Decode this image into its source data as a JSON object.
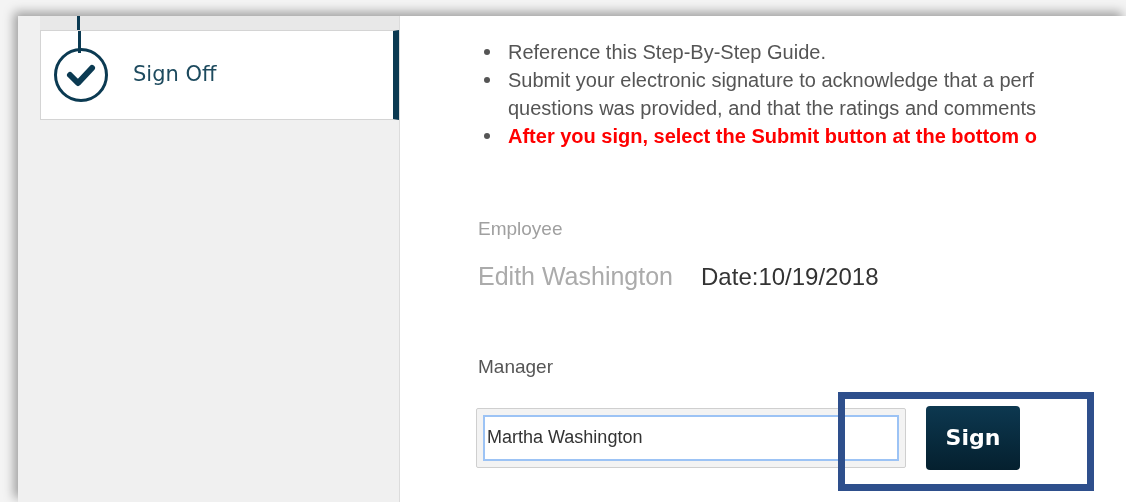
{
  "sidebar": {
    "steps": [
      {
        "label": "Sign Off",
        "completed": true,
        "selected": true
      }
    ]
  },
  "instructions": [
    {
      "kind": "normal",
      "lines": [
        "Reference this Step-By-Step Guide."
      ]
    },
    {
      "kind": "normal",
      "lines": [
        "Submit your electronic signature to acknowledge that a perf",
        "questions was provided, and that the ratings and comments"
      ]
    },
    {
      "kind": "warning",
      "lines": [
        "After you sign, select the Submit button at the bottom o"
      ]
    }
  ],
  "employee": {
    "label": "Employee",
    "name": "Edith Washington",
    "date": "Date:10/19/2018"
  },
  "manager": {
    "label": "Manager",
    "value": "Martha Washington",
    "button": "Sign",
    "highlighted": true
  }
}
